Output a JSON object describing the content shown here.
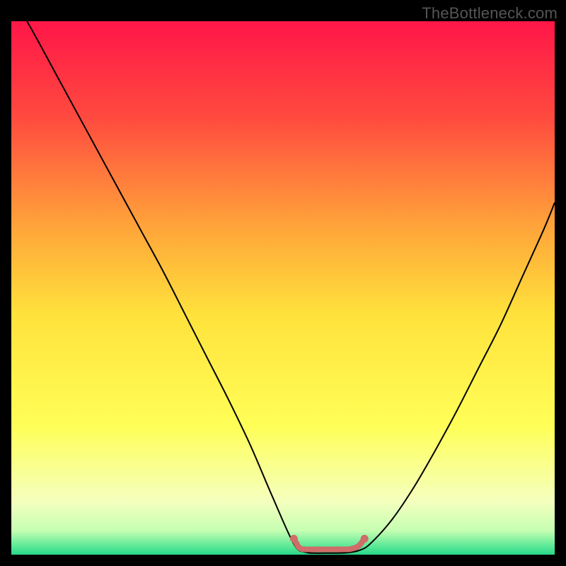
{
  "watermark": "TheBottleneck.com",
  "chart_data": {
    "type": "line",
    "title": "",
    "xlabel": "",
    "ylabel": "",
    "xlim": [
      0,
      100
    ],
    "ylim": [
      0,
      100
    ],
    "grid": false,
    "background_gradient": {
      "direction": "vertical",
      "stops": [
        {
          "pos": 0.0,
          "color": "#ff1648"
        },
        {
          "pos": 0.18,
          "color": "#ff4a3f"
        },
        {
          "pos": 0.38,
          "color": "#ffa23a"
        },
        {
          "pos": 0.55,
          "color": "#ffe23b"
        },
        {
          "pos": 0.76,
          "color": "#ffff58"
        },
        {
          "pos": 0.9,
          "color": "#f4ffbe"
        },
        {
          "pos": 0.955,
          "color": "#c6ffb2"
        },
        {
          "pos": 0.985,
          "color": "#57e896"
        },
        {
          "pos": 1.0,
          "color": "#29d78a"
        }
      ]
    },
    "series": [
      {
        "name": "bottleneck-curve",
        "color": "#000000",
        "x": [
          0.0,
          4,
          8,
          12,
          16,
          20,
          24,
          28,
          32,
          36,
          40,
          44,
          48,
          52,
          54,
          56,
          58,
          60,
          62,
          64,
          66,
          70,
          74,
          78,
          82,
          86,
          90,
          94,
          98,
          100
        ],
        "y": [
          105,
          98,
          90.5,
          83,
          75.5,
          68,
          60.5,
          53,
          45,
          37,
          29,
          20.5,
          11,
          2.0,
          0.5,
          0.3,
          0.3,
          0.3,
          0.4,
          0.8,
          2.0,
          6.5,
          12.5,
          19.5,
          27,
          35,
          43,
          52,
          61,
          66
        ]
      },
      {
        "name": "optimal-band-marker",
        "color": "#cf6d68",
        "x": [
          52,
          53,
          54,
          55,
          56,
          57,
          58,
          59,
          60,
          61,
          62,
          63,
          64,
          65
        ],
        "y": [
          3.0,
          1.3,
          1.0,
          1.0,
          1.0,
          1.0,
          1.0,
          1.0,
          1.0,
          1.0,
          1.0,
          1.2,
          1.7,
          3.0
        ]
      }
    ]
  }
}
